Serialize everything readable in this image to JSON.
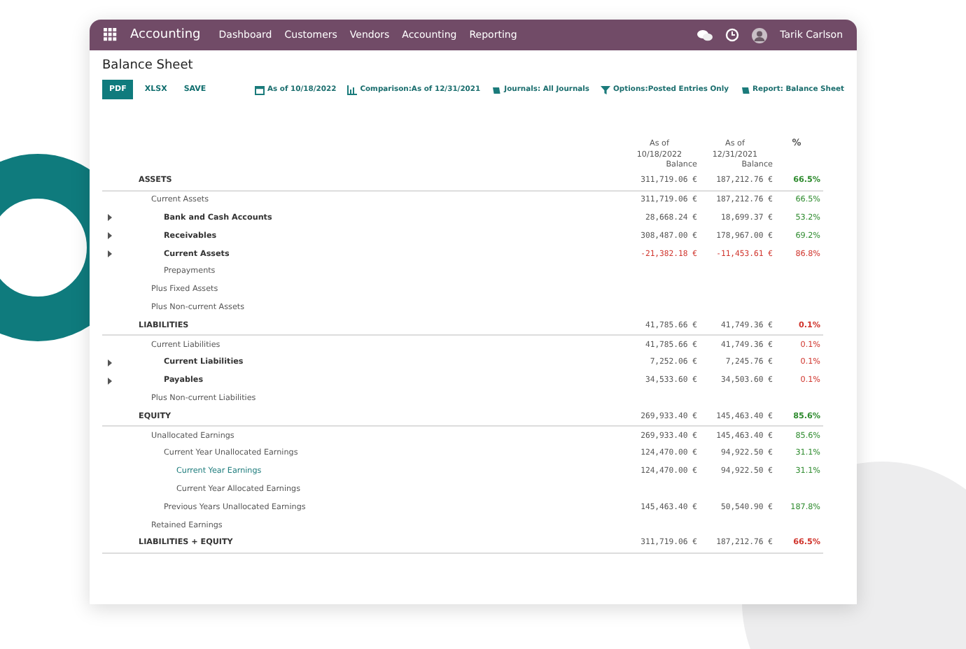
{
  "navbar": {
    "app_name": "Accounting",
    "menu": [
      {
        "label": "Dashboard"
      },
      {
        "label": "Customers"
      },
      {
        "label": "Vendors"
      },
      {
        "label": "Accounting"
      },
      {
        "label": "Reporting"
      }
    ],
    "user": "Tarik Carlson"
  },
  "title": "Balance Sheet",
  "export_buttons": [
    {
      "label": "PDF",
      "selected": true
    },
    {
      "label": "XLSX",
      "selected": false
    },
    {
      "label": "SAVE",
      "selected": false
    }
  ],
  "filters": [
    {
      "kind": "calendar",
      "label": "As of 10/18/2022"
    },
    {
      "kind": "chart",
      "label": "Comparison:As of 12/31/2021"
    },
    {
      "kind": "book",
      "label": "Journals: All Journals"
    },
    {
      "kind": "filter",
      "label": "Options:Posted Entries Only"
    },
    {
      "kind": "book",
      "label": "Report: Balance Sheet"
    }
  ],
  "columns": [
    {
      "lines": [
        "As of",
        "10/18/2022",
        "Balance"
      ]
    },
    {
      "lines": [
        "As of",
        "12/31/2021",
        "Balance"
      ]
    },
    {
      "lines": [
        "%"
      ]
    }
  ],
  "rows": [
    {
      "label": "ASSETS",
      "values": [
        "311,719.06 €",
        "187,212.76 €"
      ],
      "pct": "66.5%",
      "positive": true,
      "children": [
        {
          "label": "Current Assets",
          "values": [
            "311,719.06 €",
            "187,212.76 €"
          ],
          "pct": "66.5%",
          "positive": true,
          "children": [
            {
              "label": "Bank and Cash Accounts",
              "expandable": true,
              "values": [
                "28,668.24 €",
                "18,699.37 €"
              ],
              "pct": "53.2%",
              "positive": true
            },
            {
              "label": "Receivables",
              "expandable": true,
              "values": [
                "308,487.00 €",
                "178,967.00 €"
              ],
              "pct": "69.2%",
              "positive": true
            },
            {
              "label": "Current Assets",
              "expandable": true,
              "values": [
                "-21,382.18 €",
                "-11,453.61 €"
              ],
              "pct": "86.8%",
              "positive": false,
              "negative": true
            },
            {
              "label": "Prepayments"
            }
          ]
        },
        {
          "label": "Plus Fixed Assets"
        },
        {
          "label": "Plus Non-current Assets"
        }
      ]
    },
    {
      "label": "LIABILITIES",
      "values": [
        "41,785.66 €",
        "41,749.36 €"
      ],
      "pct": "0.1%",
      "positive": false,
      "children": [
        {
          "label": "Current Liabilities",
          "values": [
            "41,785.66 €",
            "41,749.36 €"
          ],
          "pct": "0.1%",
          "positive": false,
          "children": [
            {
              "label": "Current Liabilities",
              "expandable": true,
              "values": [
                "7,252.06 €",
                "7,245.76 €"
              ],
              "pct": "0.1%",
              "positive": false
            },
            {
              "label": "Payables",
              "expandable": true,
              "values": [
                "34,533.60 €",
                "34,503.60 €"
              ],
              "pct": "0.1%",
              "positive": false
            }
          ]
        },
        {
          "label": "Plus Non-current Liabilities"
        }
      ]
    },
    {
      "label": "EQUITY",
      "values": [
        "269,933.40 €",
        "145,463.40 €"
      ],
      "pct": "85.6%",
      "positive": true,
      "children": [
        {
          "label": "Unallocated Earnings",
          "values": [
            "269,933.40 €",
            "145,463.40 €"
          ],
          "pct": "85.6%",
          "positive": true,
          "children": [
            {
              "label": "Current Year Unallocated Earnings",
              "values": [
                "124,470.00 €",
                "94,922.50 €"
              ],
              "pct": "31.1%",
              "positive": true,
              "children": [
                {
                  "label": "Current Year Earnings",
                  "link": true,
                  "values": [
                    "124,470.00 €",
                    "94,922.50 €"
                  ],
                  "pct": "31.1%",
                  "positive": true
                },
                {
                  "label": "Current Year Allocated Earnings"
                }
              ]
            },
            {
              "label": "Previous Years Unallocated Earnings",
              "values": [
                "145,463.40 €",
                "50,540.90 €"
              ],
              "pct": "187.8%",
              "positive": true
            }
          ]
        },
        {
          "label": "Retained Earnings"
        }
      ]
    },
    {
      "label": "LIABILITIES + EQUITY",
      "values": [
        "311,719.06 €",
        "187,212.76 €"
      ],
      "pct": "66.5%",
      "positive": false
    }
  ]
}
